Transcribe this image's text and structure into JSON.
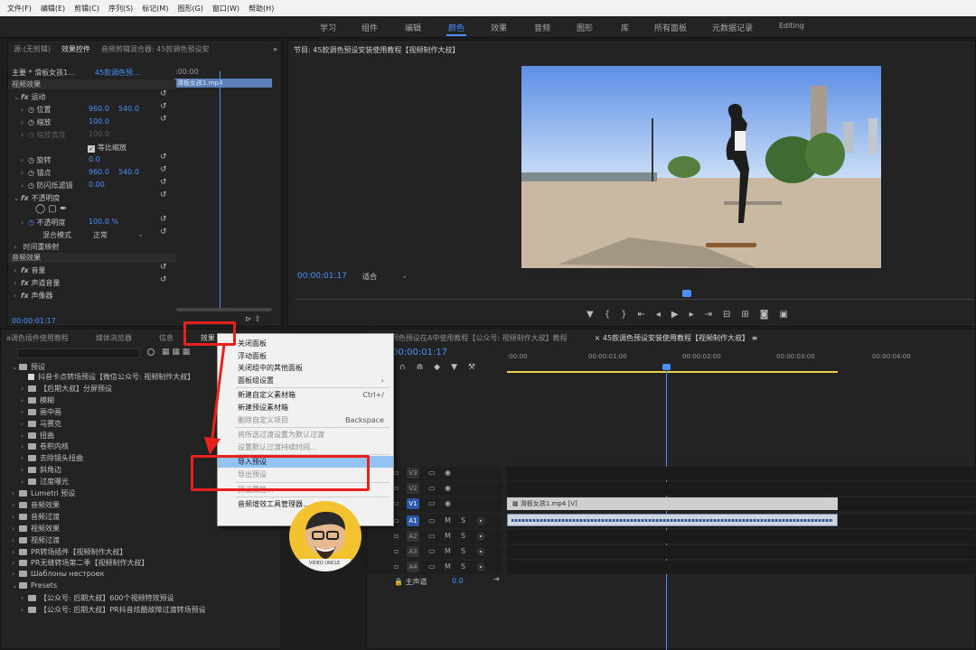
{
  "menubar": [
    "文件(F)",
    "编辑(E)",
    "剪辑(C)",
    "序列(S)",
    "标记(M)",
    "图形(G)",
    "窗口(W)",
    "帮助(H)"
  ],
  "workspaces": {
    "items": [
      "学习",
      "组件",
      "编辑",
      "颜色",
      "效果",
      "音频",
      "图形",
      "库",
      "所有面板",
      "元数据记录",
      "Editing"
    ],
    "active": "颜色",
    "accent": "#4a90ff"
  },
  "source_panel": {
    "tabs": [
      "源:(无剪辑)",
      "效果控件",
      "音频剪辑混合器: 45款调色预设安"
    ],
    "active_tab": "效果控件",
    "master": "主要 * 滑板女孩1...",
    "clip": "45款调色预...",
    "timecode_start": ":00:00",
    "clip_bar_label": "滑板女孩1.mp4",
    "video_effects_header": "视频效果",
    "rows": [
      {
        "label": "运动",
        "indent": 1,
        "fx": true
      },
      {
        "label": "位置",
        "v1": "960.0",
        "v2": "540.0"
      },
      {
        "label": "缩放",
        "v1": "100.0"
      },
      {
        "label": "缩放宽度",
        "v1": "100.0",
        "dim": true
      },
      {
        "label": "等比缩放",
        "checkbox": true
      },
      {
        "label": "旋转",
        "v1": "0.0"
      },
      {
        "label": "锚点",
        "v1": "960.0",
        "v2": "540.0"
      },
      {
        "label": "防闪烁滤镜",
        "v1": "0.00"
      },
      {
        "label": "不透明度",
        "fx": true
      },
      {
        "label": "不透明度",
        "v1": "100.0 %"
      },
      {
        "label": "混合模式",
        "v1": "正常"
      },
      {
        "label": "时间重映射"
      }
    ],
    "audio_effects_header": "音频效果",
    "audio_rows": [
      "音量",
      "声道音量",
      "声像器"
    ],
    "timecode": "00:00:01:17"
  },
  "program_panel": {
    "title": "节目: 45款调色预设安装使用教程【视频制作大叔】",
    "timecode": "00:00:01:17",
    "fit": "适合"
  },
  "effects_panel": {
    "tabs": [
      "a调色插件使用教程",
      "媒体浏览器",
      "信息",
      "效果"
    ],
    "active_tab": "效果",
    "tree": [
      {
        "label": "预设",
        "level": 0,
        "open": true
      },
      {
        "label": "抖音卡点转场预设【微信公众号: 视频制作大叔】",
        "level": 1,
        "preset": true
      },
      {
        "label": "【后期大叔】分屏预设",
        "level": 1
      },
      {
        "label": "模糊",
        "level": 1
      },
      {
        "label": "画中画",
        "level": 1
      },
      {
        "label": "马赛克",
        "level": 1
      },
      {
        "label": "扭曲",
        "level": 1
      },
      {
        "label": "卷积内核",
        "level": 1
      },
      {
        "label": "去除镜头扭曲",
        "level": 1
      },
      {
        "label": "斜角边",
        "level": 1
      },
      {
        "label": "过度曝光",
        "level": 1
      },
      {
        "label": "Lumetri 预设",
        "level": 0
      },
      {
        "label": "音频效果",
        "level": 0
      },
      {
        "label": "音频过渡",
        "level": 0
      },
      {
        "label": "视频效果",
        "level": 0
      },
      {
        "label": "视频过渡",
        "level": 0
      },
      {
        "label": "PR转场插件【视频制作大叔】",
        "level": 0
      },
      {
        "label": "PR无缝转场第二季【视频制作大叔】",
        "level": 0
      },
      {
        "label": "Шаблоны нестроек",
        "level": 0
      },
      {
        "label": "Presets",
        "level": 0,
        "open": true
      },
      {
        "label": "【公众号: 后期大叔】600个视频特效预设",
        "level": 1
      },
      {
        "label": "【公众号: 后期大叔】PR抖音炫酷故障过渡转场预设",
        "level": 1
      }
    ]
  },
  "context_menu": {
    "items": [
      {
        "label": "关闭面板"
      },
      {
        "label": "浮动面板"
      },
      {
        "label": "关闭组中的其他面板"
      },
      {
        "label": "面板组设置",
        "submenu": true
      },
      {
        "sep": true
      },
      {
        "label": "新建自定义素材箱",
        "shortcut": "Ctrl+/"
      },
      {
        "label": "新建预设素材箱"
      },
      {
        "label": "删除自定义项目",
        "shortcut": "Backspace",
        "disabled": true
      },
      {
        "sep": true
      },
      {
        "label": "将所选过渡设置为默认过渡",
        "disabled": true
      },
      {
        "label": "设置默认过渡持续时间...",
        "disabled": true
      },
      {
        "sep": true
      },
      {
        "label": "导入预设",
        "selected": true
      },
      {
        "label": "导出预设",
        "disabled": true
      },
      {
        "sep": true
      },
      {
        "label": "预设属性...",
        "disabled": true
      },
      {
        "sep": true
      },
      {
        "label": "音频增效工具管理器..."
      }
    ]
  },
  "timeline": {
    "tabs": [
      "a调色预设在A中使用教程【公众号: 视频制作大叔】教程",
      "45款调色预设安装使用教程【视频制作大叔】"
    ],
    "active_tab": "45款调色预设安装使用教程【视频制作大叔】",
    "timecode": "00:00:01:17",
    "ruler": [
      ":00:00",
      "00:00:01:00",
      "00:00:02:00",
      "00:00:03:00",
      "00:00:04:00"
    ],
    "video_tracks": [
      "V3",
      "V2",
      "V1"
    ],
    "audio_tracks": [
      "A1",
      "A2",
      "A3",
      "A4"
    ],
    "master_label": "主声道",
    "master_value": "0.0",
    "video_clip": "滑板女孩1.mp4 [V]",
    "mute": "M",
    "solo": "S"
  },
  "avatar": {
    "badge": "VIDEO UNCLE"
  },
  "annotation_color": "#e8221a"
}
